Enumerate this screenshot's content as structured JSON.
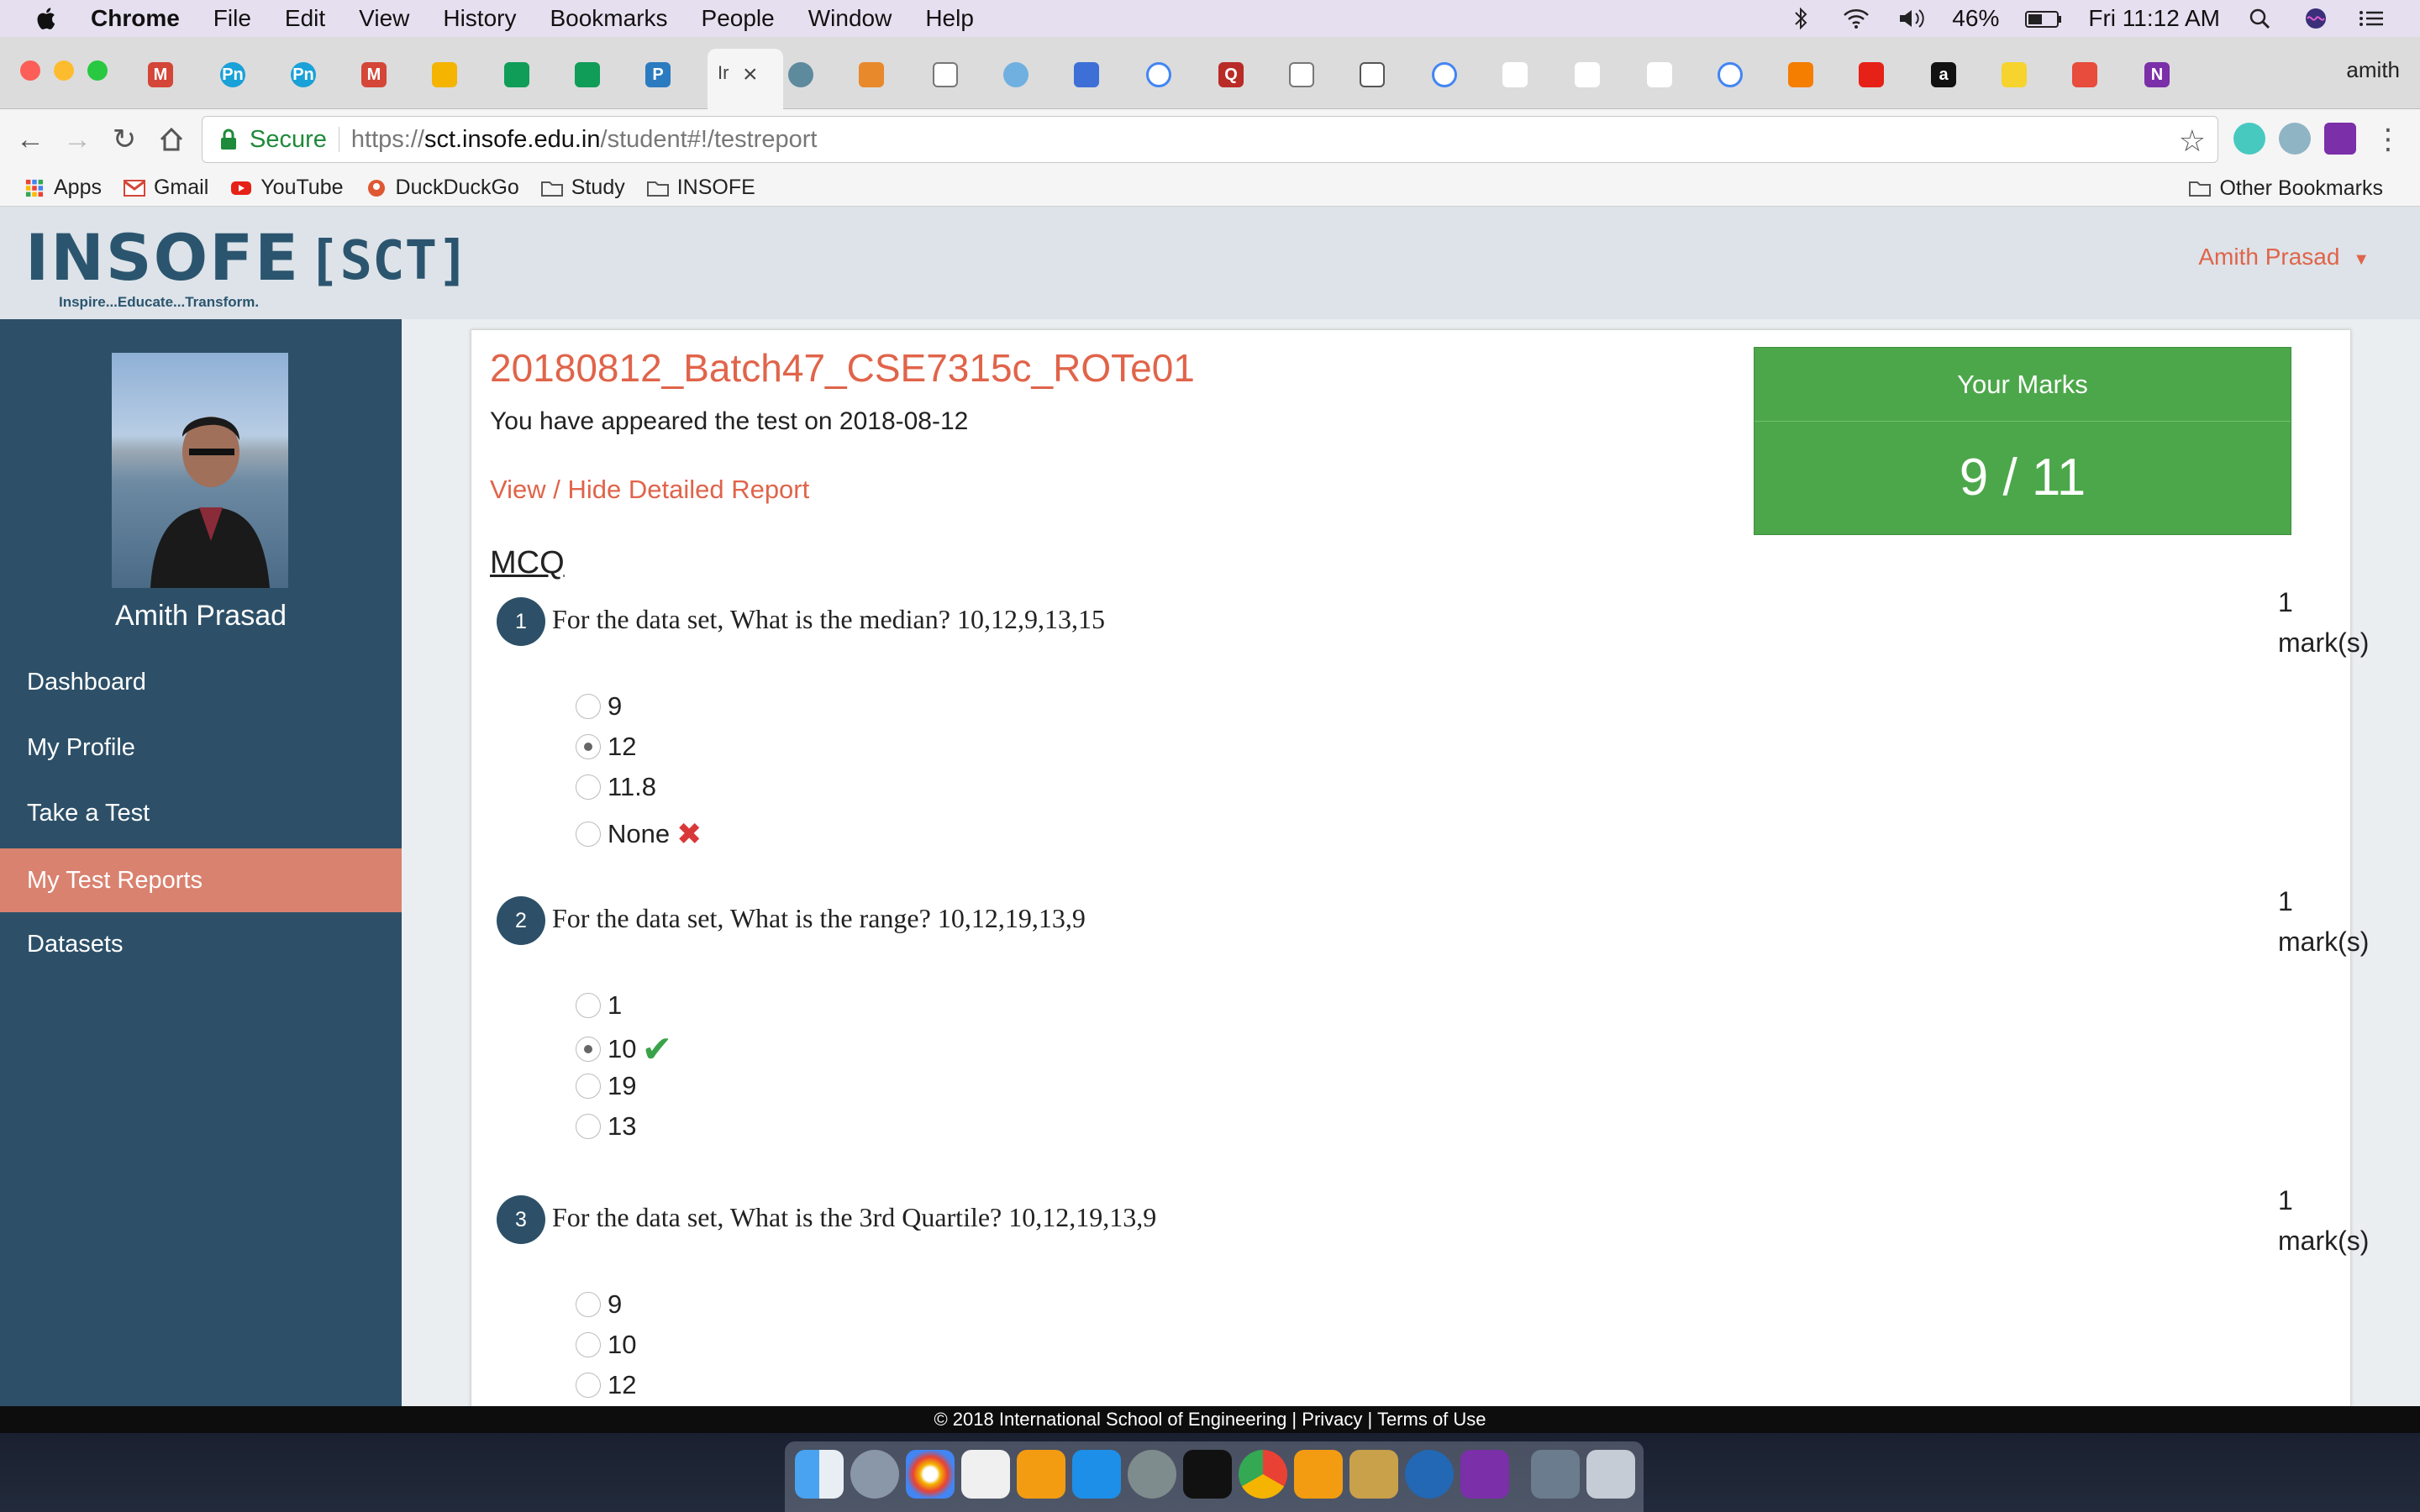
{
  "menubar": {
    "app_name": "Chrome",
    "items": [
      "File",
      "Edit",
      "View",
      "History",
      "Bookmarks",
      "People",
      "Window",
      "Help"
    ],
    "battery": "46%",
    "clock": "Fri 11:12 AM"
  },
  "tabs": {
    "user_label": "amith",
    "active_tab_label": "Ir",
    "close_glyph": "×"
  },
  "toolbar": {
    "secure_label": "Secure",
    "url_scheme": "https://",
    "url_host": "sct.insofe.edu.in",
    "url_path": "/student#!/testreport"
  },
  "bookmarks": {
    "items": [
      "Apps",
      "Gmail",
      "YouTube",
      "DuckDuckGo",
      "Study",
      "INSOFE"
    ],
    "other": "Other Bookmarks"
  },
  "header": {
    "logo_text": "INSOFE",
    "logo_tagline": "Inspire...Educate...Transform.",
    "portal": "[SCT]",
    "user": "Amith Prasad"
  },
  "sidebar": {
    "user_name": "Amith Prasad",
    "items": [
      {
        "label": "Dashboard"
      },
      {
        "label": "My Profile"
      },
      {
        "label": "Take a Test"
      },
      {
        "label": "My Test Reports"
      },
      {
        "label": "Datasets"
      }
    ],
    "active_index": 3
  },
  "report": {
    "title": "20180812_Batch47_CSE7315c_ROTe01",
    "appeared_text": "You have appeared the test on 2018-08-12",
    "toggle_link": "View / Hide Detailed Report",
    "marks_label": "Your Marks",
    "marks_value": "9 / 11",
    "section": "MCQ",
    "marks_unit": "mark(s)",
    "questions": [
      {
        "number": "1",
        "text": "For the data set, What is the median? 10,12,9,13,15",
        "marks": "1",
        "options": [
          {
            "label": "9"
          },
          {
            "label": "12",
            "selected": true
          },
          {
            "label": "11.8"
          },
          {
            "label": "None",
            "result": "wrong"
          }
        ]
      },
      {
        "number": "2",
        "text": "For the data set, What is the range? 10,12,19,13,9",
        "marks": "1",
        "options": [
          {
            "label": "1"
          },
          {
            "label": "10",
            "selected": true,
            "result": "correct"
          },
          {
            "label": "19"
          },
          {
            "label": "13"
          }
        ]
      },
      {
        "number": "3",
        "text": "For the data set, What is the 3rd Quartile? 10,12,19,13,9",
        "marks": "1",
        "options": [
          {
            "label": "9"
          },
          {
            "label": "10"
          },
          {
            "label": "12"
          }
        ]
      }
    ]
  },
  "footer": {
    "copyright": "© 2018 International School of Engineering |",
    "privacy": "Privacy |",
    "terms": "Terms of Use"
  },
  "colors": {
    "brand_orange": "#e0644a",
    "sidebar": "#2d5068",
    "active_nav": "#d9826f",
    "marks_green": "#4ca74a"
  }
}
